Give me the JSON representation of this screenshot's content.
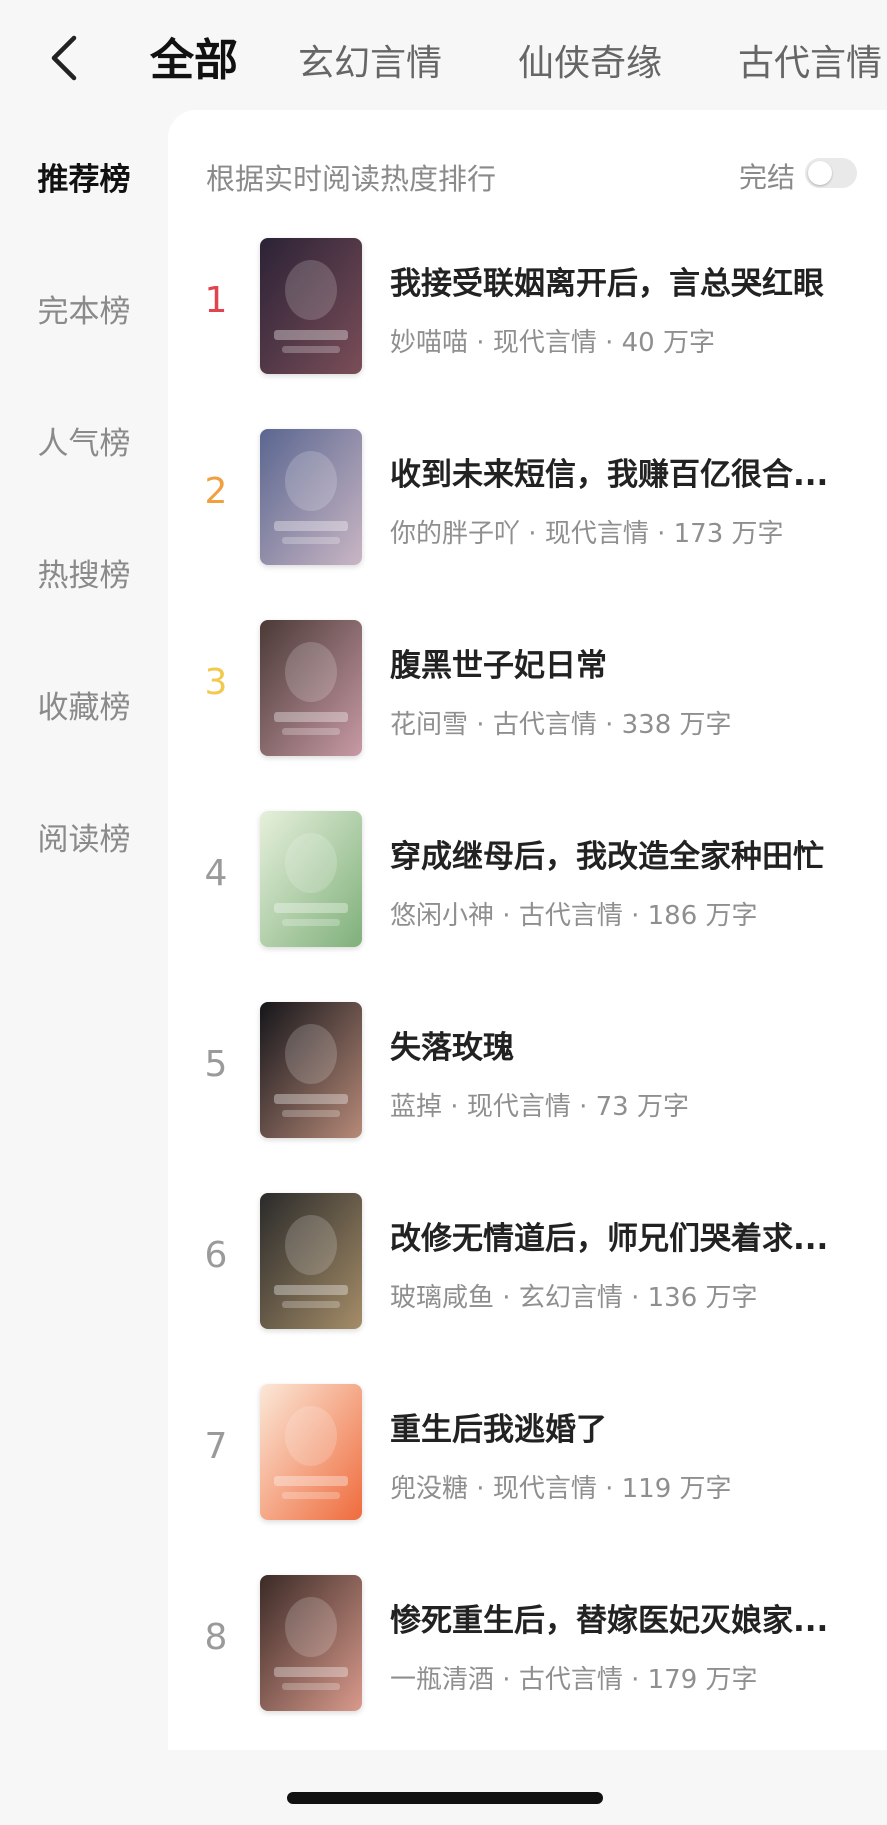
{
  "header": {
    "back_icon": "chevron-left-icon",
    "tabs": [
      "全部",
      "玄幻言情",
      "仙侠奇缘",
      "古代言情"
    ],
    "active_tab": 0
  },
  "sidebar": {
    "items": [
      "推荐榜",
      "完本榜",
      "人气榜",
      "热搜榜",
      "收藏榜",
      "阅读榜"
    ],
    "active_index": 0
  },
  "panel": {
    "subtitle": "根据实时阅读热度排行",
    "finished_label": "完结",
    "finished_toggle_on": false
  },
  "books": [
    {
      "rank": "1",
      "title": "我接受联姻离开后，言总哭红眼",
      "author": "妙喵喵",
      "genre": "现代言情",
      "words": "40 万字",
      "rank_color": "#e0454f",
      "cover_colors": [
        "#2b2236",
        "#7a4e58"
      ]
    },
    {
      "rank": "2",
      "title": "收到未来短信，我赚百亿很合...",
      "author": "你的胖子吖",
      "genre": "现代言情",
      "words": "173 万字",
      "rank_color": "#f0a040",
      "cover_colors": [
        "#5a6690",
        "#c9b6c4"
      ]
    },
    {
      "rank": "3",
      "title": "腹黑世子妃日常",
      "author": "花间雪",
      "genre": "古代言情",
      "words": "338 万字",
      "rank_color": "#f2c94c",
      "cover_colors": [
        "#4a3a36",
        "#c89aa5"
      ]
    },
    {
      "rank": "4",
      "title": "穿成继母后，我改造全家种田忙",
      "author": "悠闲小神",
      "genre": "古代言情",
      "words": "186 万字",
      "rank_color": "#9a9a9a",
      "cover_colors": [
        "#e6f0dc",
        "#7fb07a"
      ]
    },
    {
      "rank": "5",
      "title": "失落玫瑰",
      "author": "蓝掉",
      "genre": "现代言情",
      "words": "73 万字",
      "rank_color": "#9a9a9a",
      "cover_colors": [
        "#15151a",
        "#b78a78"
      ]
    },
    {
      "rank": "6",
      "title": "改修无情道后，师兄们哭着求...",
      "author": "玻璃咸鱼",
      "genre": "玄幻言情",
      "words": "136 万字",
      "rank_color": "#9a9a9a",
      "cover_colors": [
        "#2a2a2a",
        "#a58d68"
      ]
    },
    {
      "rank": "7",
      "title": "重生后我逃婚了",
      "author": "兜没糖",
      "genre": "现代言情",
      "words": "119 万字",
      "rank_color": "#9a9a9a",
      "cover_colors": [
        "#fbe8d8",
        "#ef6b3c"
      ]
    },
    {
      "rank": "8",
      "title": "惨死重生后，替嫁医妃灭娘家...",
      "author": "一瓶清酒",
      "genre": "古代言情",
      "words": "179 万字",
      "rank_color": "#9a9a9a",
      "cover_colors": [
        "#3b2a26",
        "#d99a8c"
      ]
    }
  ]
}
